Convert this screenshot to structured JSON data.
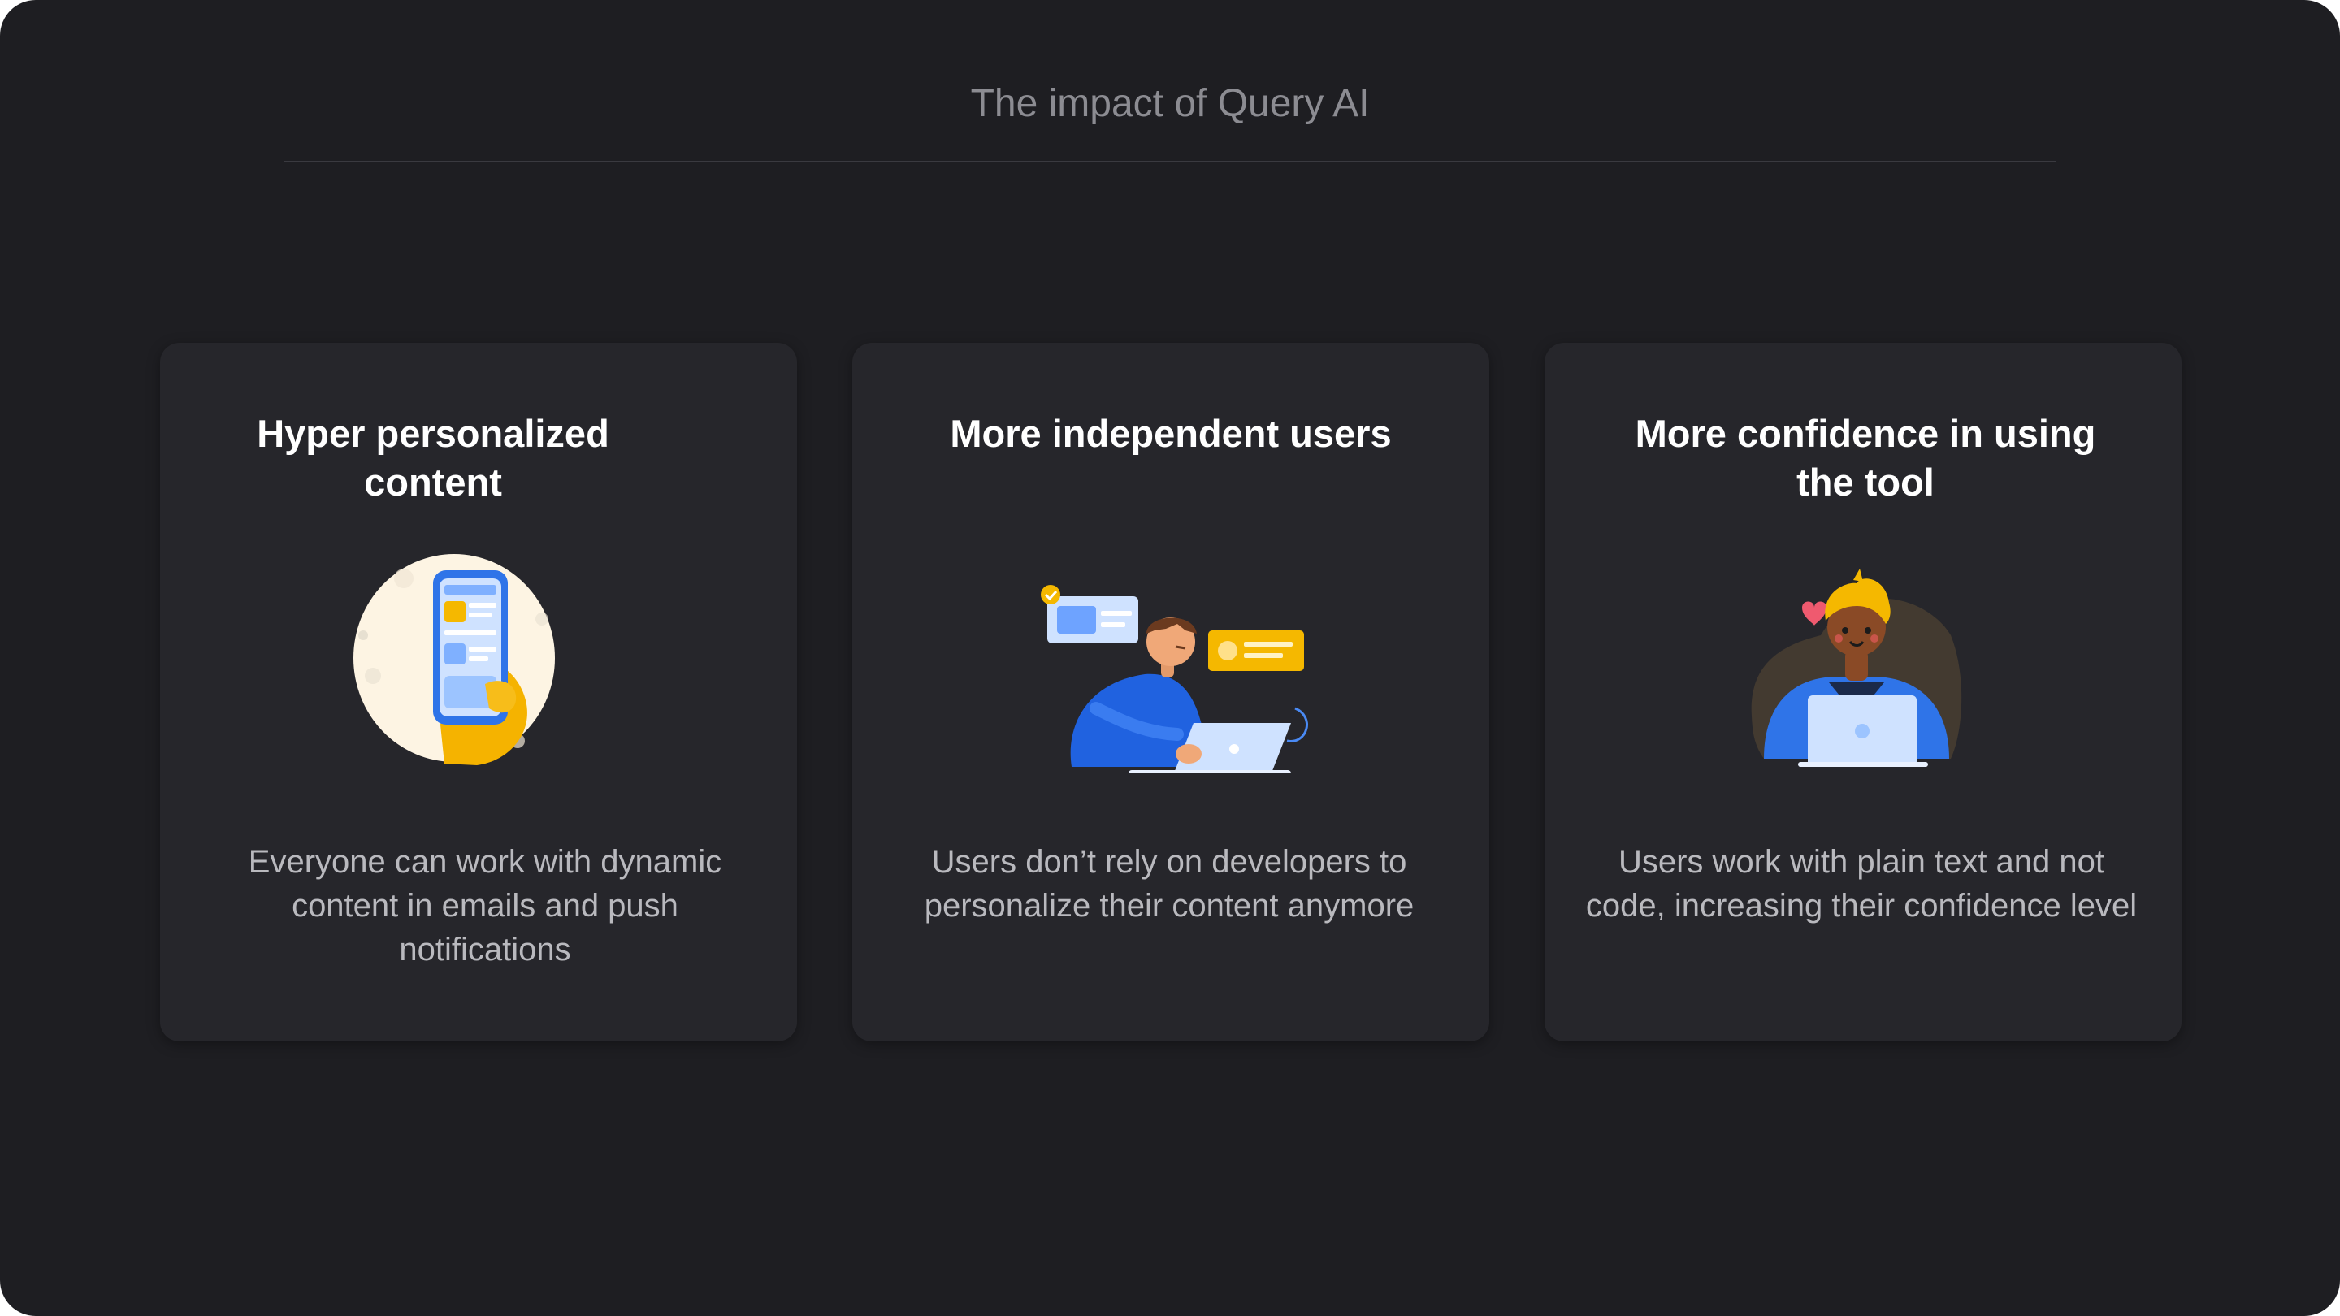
{
  "header": {
    "title": "The impact of Query AI"
  },
  "cards": [
    {
      "title": "Hyper personalized content",
      "description": "Everyone can work with dynamic content in emails and push notifications",
      "illustration": "hand-holding-phone-illustration"
    },
    {
      "title": "More independent users",
      "description": "Users don’t rely on developers to personalize their content anymore",
      "illustration": "person-with-laptop-illustration"
    },
    {
      "title": "More confidence in using the tool",
      "description": "Users work with plain text and not code, increasing their confidence level",
      "illustration": "confident-user-laptop-illustration"
    }
  ],
  "colors": {
    "background": "#1e1e22",
    "card": "#26262b",
    "title_text": "#ffffff",
    "body_text": "#b9b9be",
    "muted_title": "#8c8c92",
    "accent_blue": "#2f74e8",
    "accent_yellow": "#f5b800"
  }
}
